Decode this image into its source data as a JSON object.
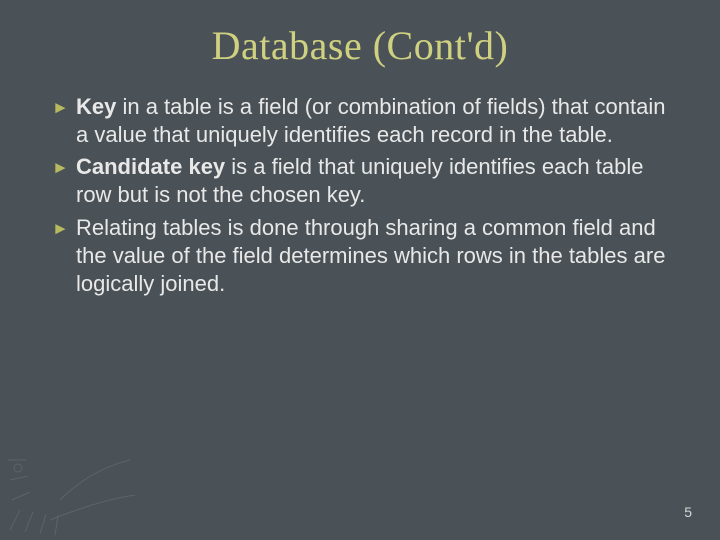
{
  "title": "Database (Cont'd)",
  "bullets": [
    {
      "lead": "Key",
      "rest": " in a table is a field (or combination of fields) that contain a value that uniquely identifies each record in the table."
    },
    {
      "lead": "Candidate key",
      "rest": " is a field that uniquely identifies each table row but is not the chosen key."
    },
    {
      "lead": "",
      "rest": "Relating tables is done through sharing a common field and the value of the field determines which rows in the tables are logically joined."
    }
  ],
  "page_number": "5"
}
